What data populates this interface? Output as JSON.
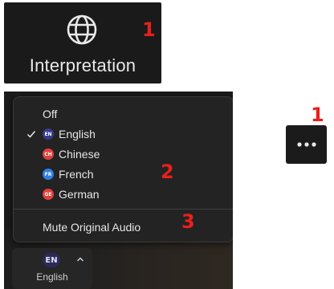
{
  "toolbar": {
    "label": "Interpretation",
    "icon": "globe-icon"
  },
  "step_labels": {
    "toolbar": "1",
    "languages": "2",
    "mute": "3",
    "more": "1"
  },
  "menu": {
    "off_label": "Off",
    "languages": [
      {
        "code": "EN",
        "name": "English",
        "color": "#3a3a8c",
        "selected": true
      },
      {
        "code": "CH",
        "name": "Chinese",
        "color": "#e0403c",
        "selected": false
      },
      {
        "code": "FR",
        "name": "French",
        "color": "#2f7fe0",
        "selected": false
      },
      {
        "code": "GE",
        "name": "German",
        "color": "#e0403c",
        "selected": false
      }
    ],
    "mute_label": "Mute Original Audio"
  },
  "language_button": {
    "code": "EN",
    "label": "English",
    "icon": "chevron-up-icon"
  },
  "more_button": {
    "icon": "more-icon"
  }
}
